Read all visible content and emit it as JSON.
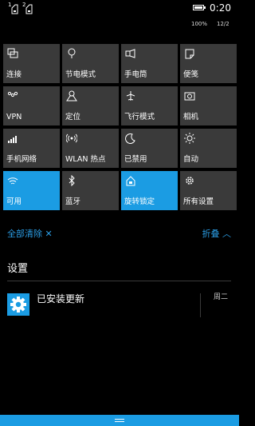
{
  "status": {
    "sim1": "1",
    "sim2": "2",
    "time": "0:20",
    "battery": "100%",
    "date": "12/2",
    "battery_level": 1.0
  },
  "tiles": [
    {
      "label": "连接",
      "icon": "connect-icon",
      "on": false
    },
    {
      "label": "节电模式",
      "icon": "battery-saver-icon",
      "on": false
    },
    {
      "label": "手电筒",
      "icon": "flashlight-icon",
      "on": false
    },
    {
      "label": "便笺",
      "icon": "note-icon",
      "on": false
    },
    {
      "label": "VPN",
      "icon": "vpn-icon",
      "on": false
    },
    {
      "label": "定位",
      "icon": "location-icon",
      "on": false
    },
    {
      "label": "飞行模式",
      "icon": "airplane-icon",
      "on": false
    },
    {
      "label": "相机",
      "icon": "camera-icon",
      "on": false
    },
    {
      "label": "手机网络",
      "icon": "cellular-icon",
      "on": false
    },
    {
      "label": "WLAN 热点",
      "icon": "hotspot-icon",
      "on": false
    },
    {
      "label": "已禁用",
      "icon": "moon-icon",
      "on": false
    },
    {
      "label": "自动",
      "icon": "brightness-icon",
      "on": false
    },
    {
      "label": "可用",
      "icon": "wifi-icon",
      "on": true
    },
    {
      "label": "蓝牙",
      "icon": "bluetooth-icon",
      "on": false
    },
    {
      "label": "旋转锁定",
      "icon": "rotation-lock-icon",
      "on": true
    },
    {
      "label": "所有设置",
      "icon": "settings-icon",
      "on": false
    }
  ],
  "actions": {
    "clear_all": "全部清除 ✕",
    "collapse": "折叠 ︿"
  },
  "section": {
    "title": "设置"
  },
  "notification": {
    "title": "已安装更新",
    "time": "周二",
    "icon": "gear-icon"
  },
  "colors": {
    "accent": "#1b9ce3",
    "tile": "#3a3a3a",
    "link": "#2b9ee6",
    "background": "#000000"
  }
}
